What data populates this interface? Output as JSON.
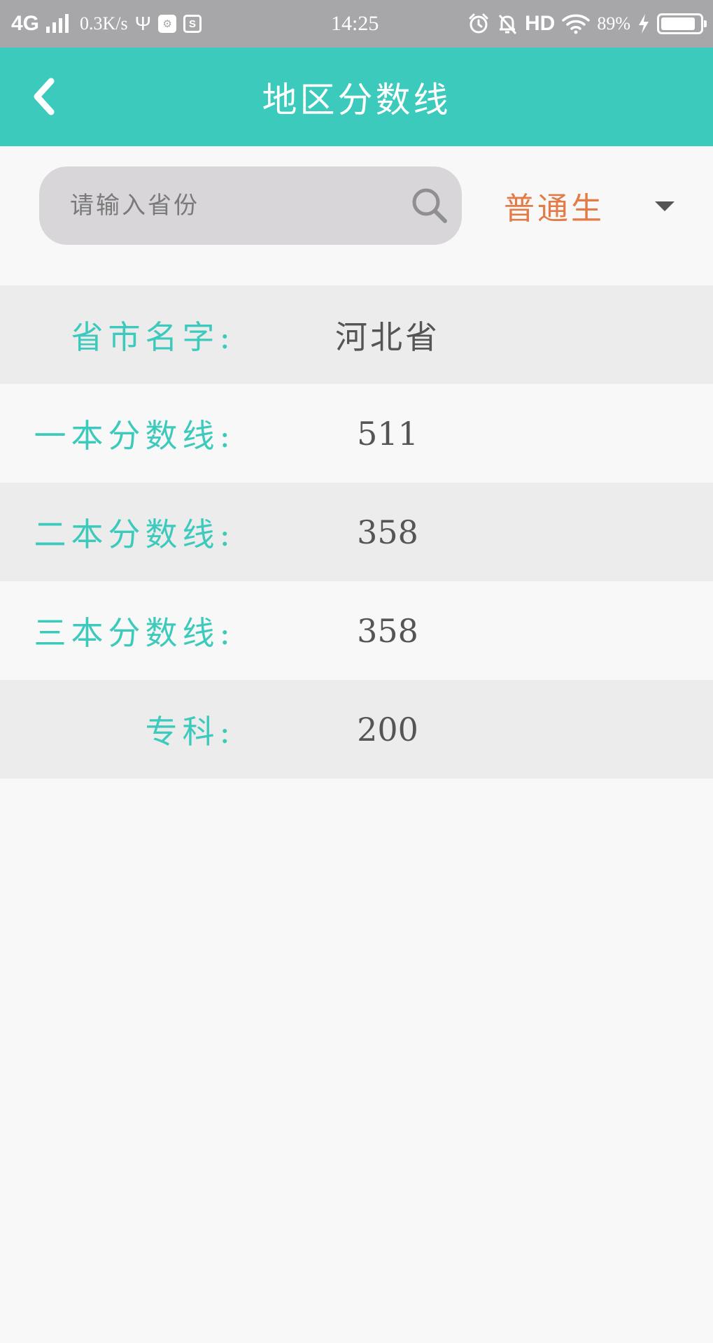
{
  "status_bar": {
    "network": "4G",
    "speed": "0.3K/s",
    "time": "14:25",
    "hd": "HD",
    "battery_pct": "89%",
    "battery_level": 0.89
  },
  "header": {
    "title": "地区分数线",
    "back_icon": "chevron-left-icon"
  },
  "search": {
    "placeholder": "请输入省份",
    "value": "",
    "icon": "search-icon"
  },
  "type_select": {
    "selected": "普通生",
    "icon": "chevron-down-icon"
  },
  "scores": [
    {
      "label": "省市名字:",
      "value": "河北省"
    },
    {
      "label": "一本分数线:",
      "value": "511"
    },
    {
      "label": "二本分数线:",
      "value": "358"
    },
    {
      "label": "三本分数线:",
      "value": "358"
    },
    {
      "label": "专科:",
      "value": "200"
    }
  ],
  "colors": {
    "accent": "#3ccabc",
    "select_text": "#e27b46",
    "status_bar": "#a7a6a9",
    "row_shade": "#ececed",
    "value_text": "#555555"
  }
}
